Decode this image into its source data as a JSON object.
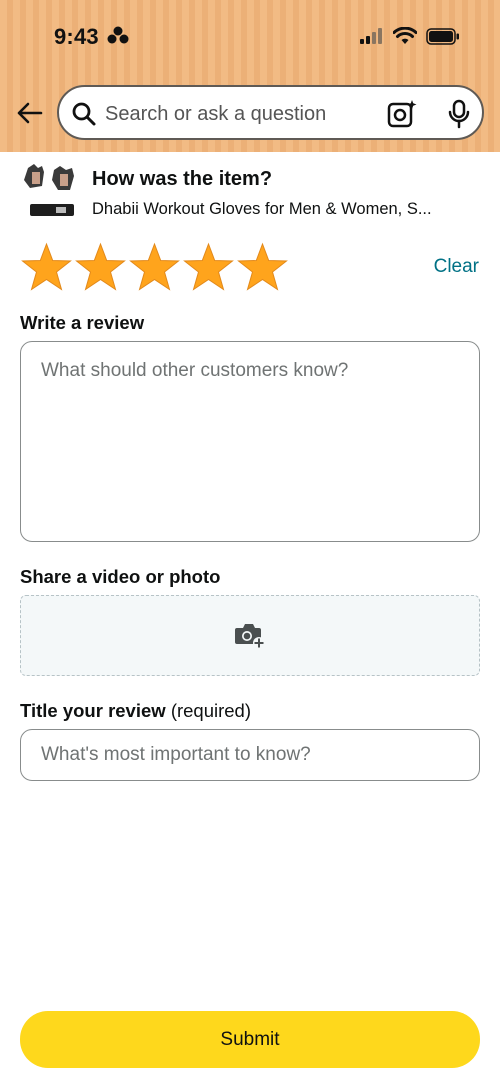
{
  "status_bar": {
    "time": "9:43",
    "extra_icon": "clover-icon",
    "cellular_icon": "cellular-signal-icon",
    "wifi_icon": "wifi-icon",
    "battery_icon": "battery-icon"
  },
  "search": {
    "placeholder": "Search or ask a question",
    "back_icon": "back-arrow-icon",
    "search_icon": "search-icon",
    "camera_icon": "camera-lens-icon",
    "mic_icon": "microphone-icon"
  },
  "product": {
    "question": "How was the item?",
    "name": "Dhabii Workout Gloves for Men & Women, S..."
  },
  "rating": {
    "stars_filled": 5,
    "stars_total": 5,
    "star_color": "#ffa41c",
    "clear_label": "Clear"
  },
  "review": {
    "label": "Write a review",
    "placeholder": "What should other customers know?"
  },
  "media": {
    "label": "Share a video or photo",
    "upload_icon": "add-photo-icon"
  },
  "title_field": {
    "label": "Title your review",
    "label_suffix": "(required)",
    "placeholder": "What's most important to know?"
  },
  "submit": {
    "label": "Submit",
    "color": "#fed81c"
  },
  "colors": {
    "header_bg": "#f2bb84",
    "link": "#007185"
  }
}
